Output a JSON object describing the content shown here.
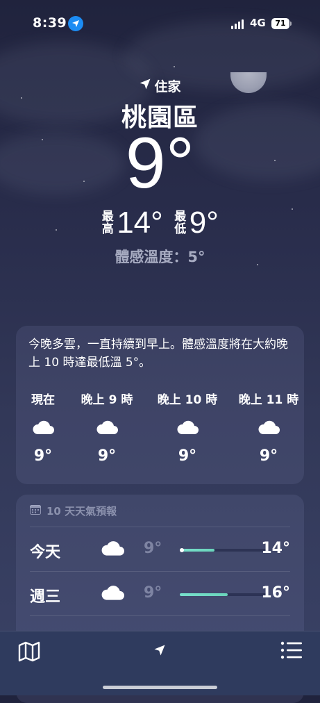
{
  "status_bar": {
    "time": "8:39",
    "network": "4G",
    "battery": "71"
  },
  "location": {
    "label": "住家",
    "city": "桃園區"
  },
  "current": {
    "temperature": "9°",
    "high_label": "最高",
    "high": "14°",
    "low_label": "最低",
    "low": "9°",
    "feels_like": "體感溫度：5°"
  },
  "hourly": {
    "summary": "今晚多雲，一直持續到早上。體感溫度將在大約晚上 10 時達最低溫 5°。",
    "items": [
      {
        "label": "現在",
        "icon": "cloud-icon",
        "temp": "9°"
      },
      {
        "label": "晚上 9 時",
        "icon": "cloud-icon",
        "temp": "9°"
      },
      {
        "label": "晚上 10 時",
        "icon": "cloud-icon",
        "temp": "9°"
      },
      {
        "label": "晚上 11 時",
        "icon": "cloud-icon",
        "temp": "9°"
      }
    ]
  },
  "daily": {
    "header": "10 天天氣預報",
    "days": [
      {
        "day": "今天",
        "icon": "cloud-icon",
        "low": "9°",
        "high": "14°",
        "range_start": 0.0,
        "range_end": 0.4,
        "current_marker": 0.0
      },
      {
        "day": "週三",
        "icon": "cloud-icon",
        "low": "9°",
        "high": "16°",
        "range_start": 0.0,
        "range_end": 0.55
      }
    ]
  },
  "tabbar": {
    "map": "map-icon",
    "location": "location-arrow-icon",
    "list": "list-icon"
  },
  "colors": {
    "accent_location": "#1c8cf3",
    "temp_bar": "#78e0cc"
  }
}
